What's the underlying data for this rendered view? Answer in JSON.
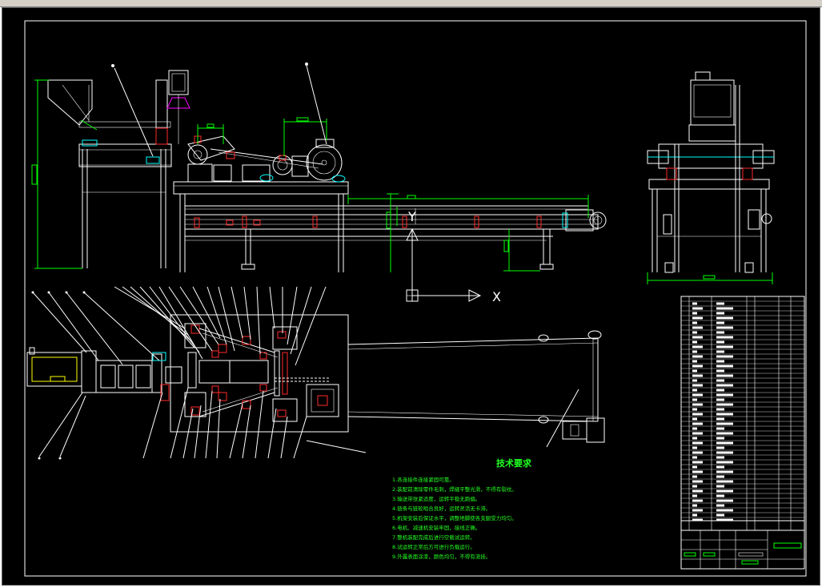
{
  "tech_requirements": {
    "title": "技术要求",
    "items": [
      "1.各连接件连接紧固可靠。",
      "2.装配前清除零件毛刺，焊缝平整光滑，不得有裂纹。",
      "3.输送带张紧适度，运转平稳无跑偏。",
      "4.链条与链轮啮合良好，运转灵活无卡滞。",
      "5.机架安装后保证水平，调整地脚使各支腿受力均匀。",
      "6.电机、减速机安装牢固，接线正确。",
      "7.整机装配完成后进行空载试运转。",
      "8.试运转正常后方可进行负载运行。",
      "9.外露表面涂漆，颜色均匀，不得有流挂。"
    ]
  },
  "axis_labels": {
    "x": "X",
    "y": "Y"
  },
  "colors": {
    "background": "#000000",
    "frame": "#ffffff",
    "red": "#ff2a2a",
    "cyan": "#00ffff",
    "green": "#00ff00",
    "magenta": "#ff00ff",
    "yellow": "#ffff00"
  }
}
